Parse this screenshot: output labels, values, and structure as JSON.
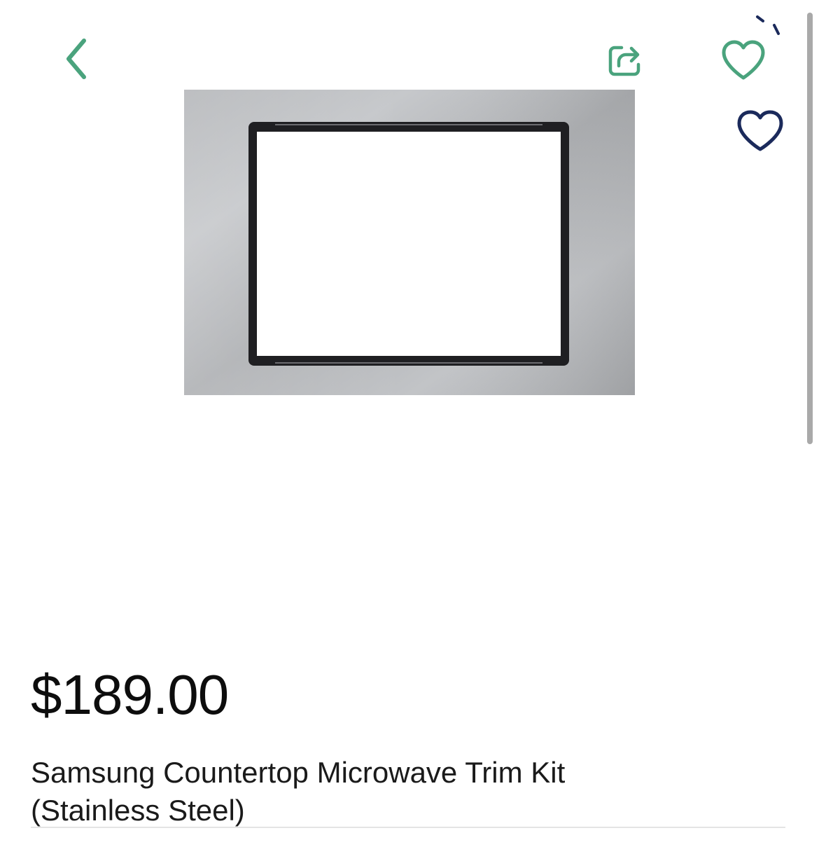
{
  "header": {
    "back_icon": "chevron-left-icon",
    "share_icon": "share-icon",
    "favorite_icon": "heart-outline-icon",
    "accent_color": "#4aa37d",
    "navy_color": "#1b2a5b"
  },
  "product": {
    "image_icon": "microwave-trim-kit-image",
    "price": "$189.00",
    "title_line1": "Samsung Countertop Microwave Trim Kit",
    "title_line2": "(Stainless Steel)"
  }
}
